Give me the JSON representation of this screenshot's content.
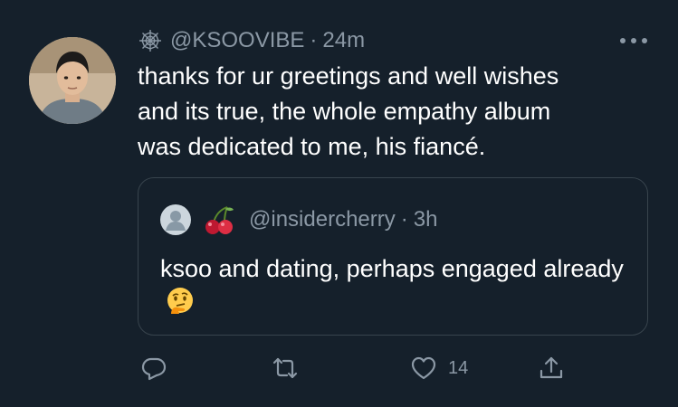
{
  "tweet": {
    "handle": "@KSOOVIBE",
    "separator": "·",
    "time": "24m",
    "text": "thanks for ur greetings and well wishes\nand its true, the whole empathy album\nwas dedicated to me, his fiancé."
  },
  "quoted_tweet": {
    "handle": "@insidercherry",
    "separator": "·",
    "time": "3h",
    "text": "ksoo and dating, perhaps engaged already"
  },
  "actions": {
    "like_count": "14"
  },
  "icons": {
    "header_badge": "spiderweb-icon",
    "more": "more-icon",
    "quoted_avatar": "default-avatar-icon",
    "quoted_badge": "cherry-icon",
    "quoted_text_emoji": "thinking-face-emoji",
    "reply": "reply-icon",
    "retweet": "retweet-icon",
    "like": "heart-icon",
    "share": "share-icon"
  },
  "colors": {
    "background": "#15202b",
    "secondary_text": "#8b98a5",
    "primary_text": "#ffffff",
    "border": "#38444d"
  }
}
